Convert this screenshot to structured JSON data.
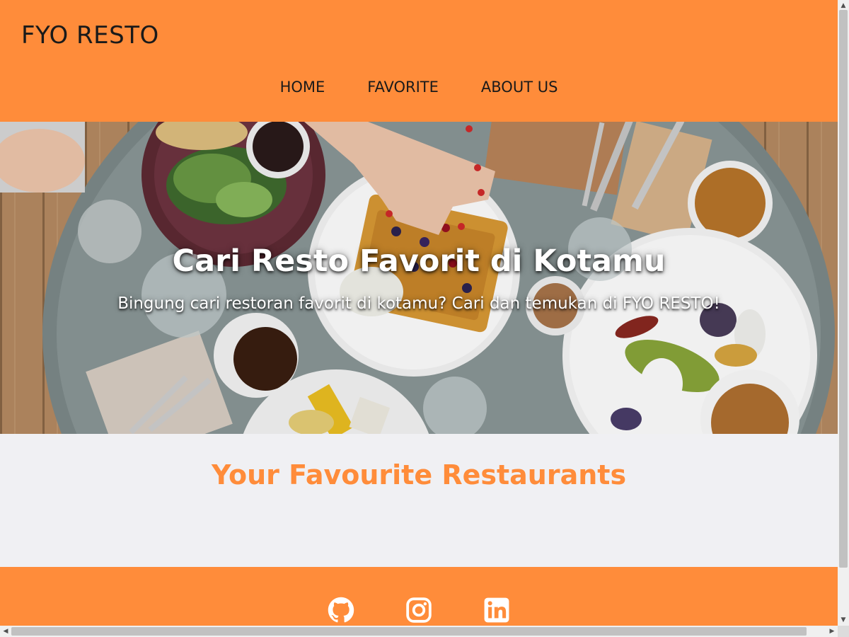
{
  "header": {
    "brand": "FYO RESTO",
    "nav": [
      {
        "label": "HOME"
      },
      {
        "label": "FAVORITE"
      },
      {
        "label": "ABOUT US"
      }
    ]
  },
  "hero": {
    "title": "Cari Resto Favorit di Kotamu",
    "subtitle": "Bingung cari restoran favorit di kotamu? Cari dan temukan di FYO RESTO!",
    "image_icon": "food-table-photo"
  },
  "main": {
    "section_title": "Your Favourite Restaurants"
  },
  "footer": {
    "social": [
      {
        "icon": "github-icon"
      },
      {
        "icon": "instagram-icon"
      },
      {
        "icon": "linkedin-icon"
      }
    ]
  },
  "colors": {
    "accent": "#ff8c3a",
    "background": "#f0f0f3",
    "text": "#1a1a1a"
  }
}
